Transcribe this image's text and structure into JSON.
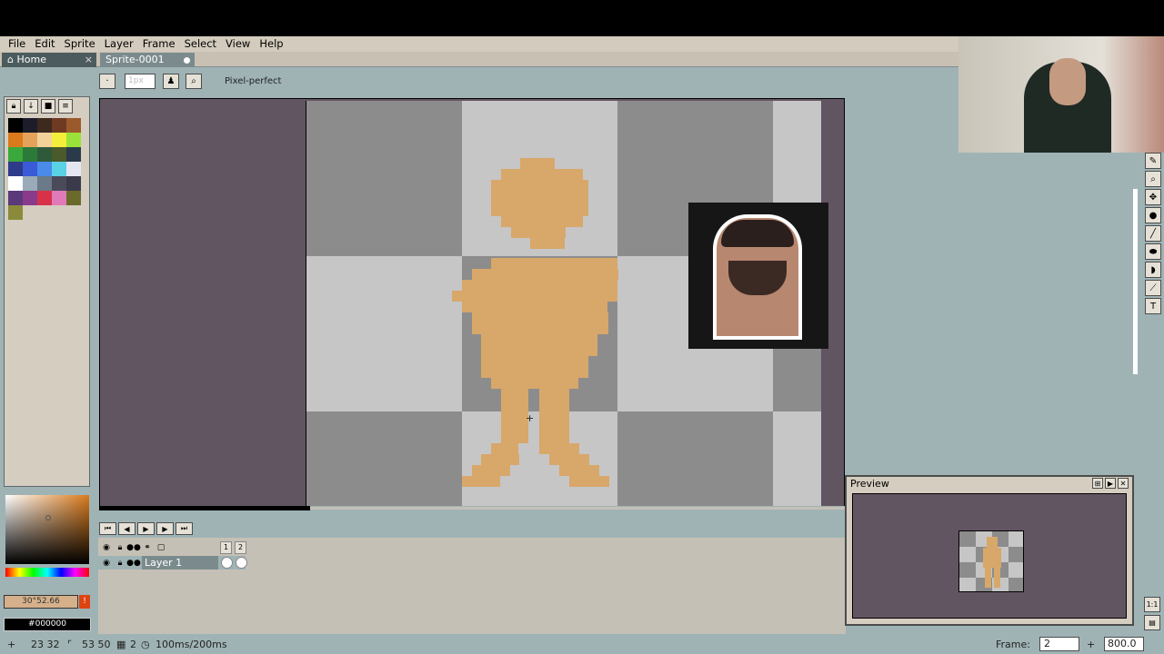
{
  "menu": {
    "items": [
      "File",
      "Edit",
      "Sprite",
      "Layer",
      "Frame",
      "Select",
      "View",
      "Help"
    ]
  },
  "tabs": [
    {
      "label": "Home",
      "icon": "home-icon",
      "close": "×"
    },
    {
      "label": "Sprite-0001",
      "modified": true
    }
  ],
  "toolbar": {
    "brush_size_value": "1px",
    "pixel_perfect_label": "Pixel-perfect"
  },
  "palette": {
    "swatches": [
      "#000000",
      "#1c1c2a",
      "#3d2a1e",
      "#6e3a22",
      "#9b5a2c",
      "#d97a1c",
      "#e6a25a",
      "#f3d29a",
      "#f3ee3a",
      "#9ae23a",
      "#3aa83a",
      "#2b7a3a",
      "#2f5a3a",
      "#4a5a2a",
      "#2a3a4a",
      "#2e3a8a",
      "#3a5ad8",
      "#4a8ae8",
      "#5ad2e6",
      "#e6e6f2",
      "#ffffff",
      "#9aaab8",
      "#6a7a88",
      "#4a4a5a",
      "#3a3a4a",
      "#5a3a7a",
      "#8a3a8a",
      "#d8324a",
      "#e07ab8",
      "#6a6a2a",
      "#8a8a3a"
    ]
  },
  "colors": {
    "foreground_label": "30°52.66",
    "background_label": "#000000",
    "skin": "#d8a76a",
    "canvas_bg": "#625562"
  },
  "timeline": {
    "frames": [
      "1",
      "2"
    ],
    "layer_name": "Layer 1"
  },
  "preview": {
    "title": "Preview"
  },
  "side_buttons": {
    "fit_label": "1:1"
  },
  "status": {
    "cursor_pos": "23 32",
    "selection_size": "53 50",
    "frame_count": "2",
    "duration": "100ms/200ms",
    "frame_label": "Frame:",
    "frame_value": "2",
    "zoom_value": "800.0"
  }
}
